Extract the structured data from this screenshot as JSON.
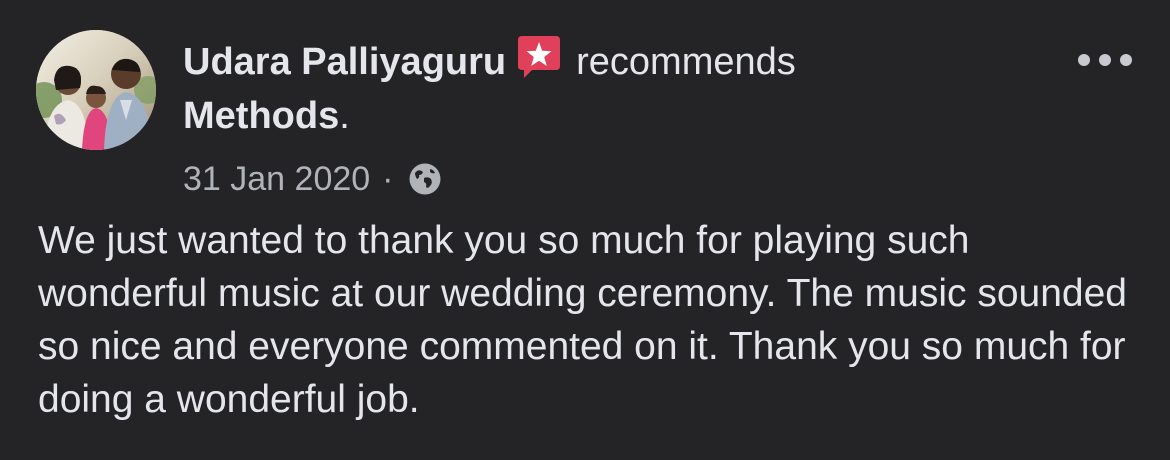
{
  "post": {
    "author": "Udara Palliyaguru",
    "action": "recommends",
    "page_name": "Methods",
    "page_suffix": ".",
    "date": "31 Jan 2020",
    "separator": "·",
    "audience_icon": "globe-icon",
    "recommend_icon": "star-speech-bubble-icon",
    "menu_icon": "more-options-icon",
    "text": "We just wanted to thank you so much for playing such wonderful music at our wedding ceremony. The music sounded so nice and everyone commented on it. Thank you so much for doing a wonderful job."
  },
  "colors": {
    "background": "#242427",
    "primary_text": "#e4e6eb",
    "secondary_text": "#b0b3b8",
    "recommend_badge": "#e0405a"
  }
}
